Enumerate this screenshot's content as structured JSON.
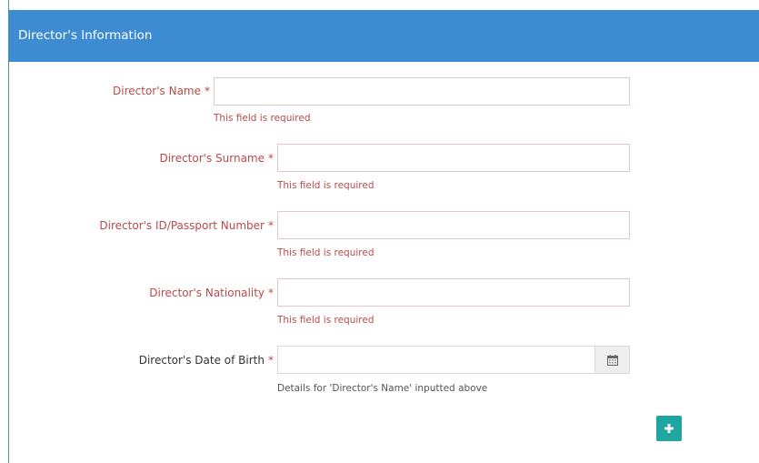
{
  "panel": {
    "title": "Director's Information"
  },
  "fields": {
    "name": {
      "label": "Director's Name",
      "required_mark": "*",
      "value": "",
      "help": "This field is required"
    },
    "surname": {
      "label": "Director's Surname",
      "required_mark": "*",
      "value": "",
      "help": "This field is required"
    },
    "id_number": {
      "label": "Director's ID/Passport Number",
      "required_mark": "*",
      "value": "",
      "help": "This field is required"
    },
    "nationality": {
      "label": "Director's Nationality",
      "required_mark": "*",
      "value": "",
      "help": "This field is required"
    },
    "dob": {
      "label": "Director's Date of Birth",
      "required_mark": "*",
      "value": "",
      "help": "Details for 'Director's Name' inputted above",
      "addon_icon": "calendar-icon"
    }
  },
  "actions": {
    "add_icon": "plus-icon"
  },
  "colors": {
    "header_bg": "#3d8bd0",
    "error_text": "#b94a48",
    "add_button": "#1fa6a0"
  }
}
